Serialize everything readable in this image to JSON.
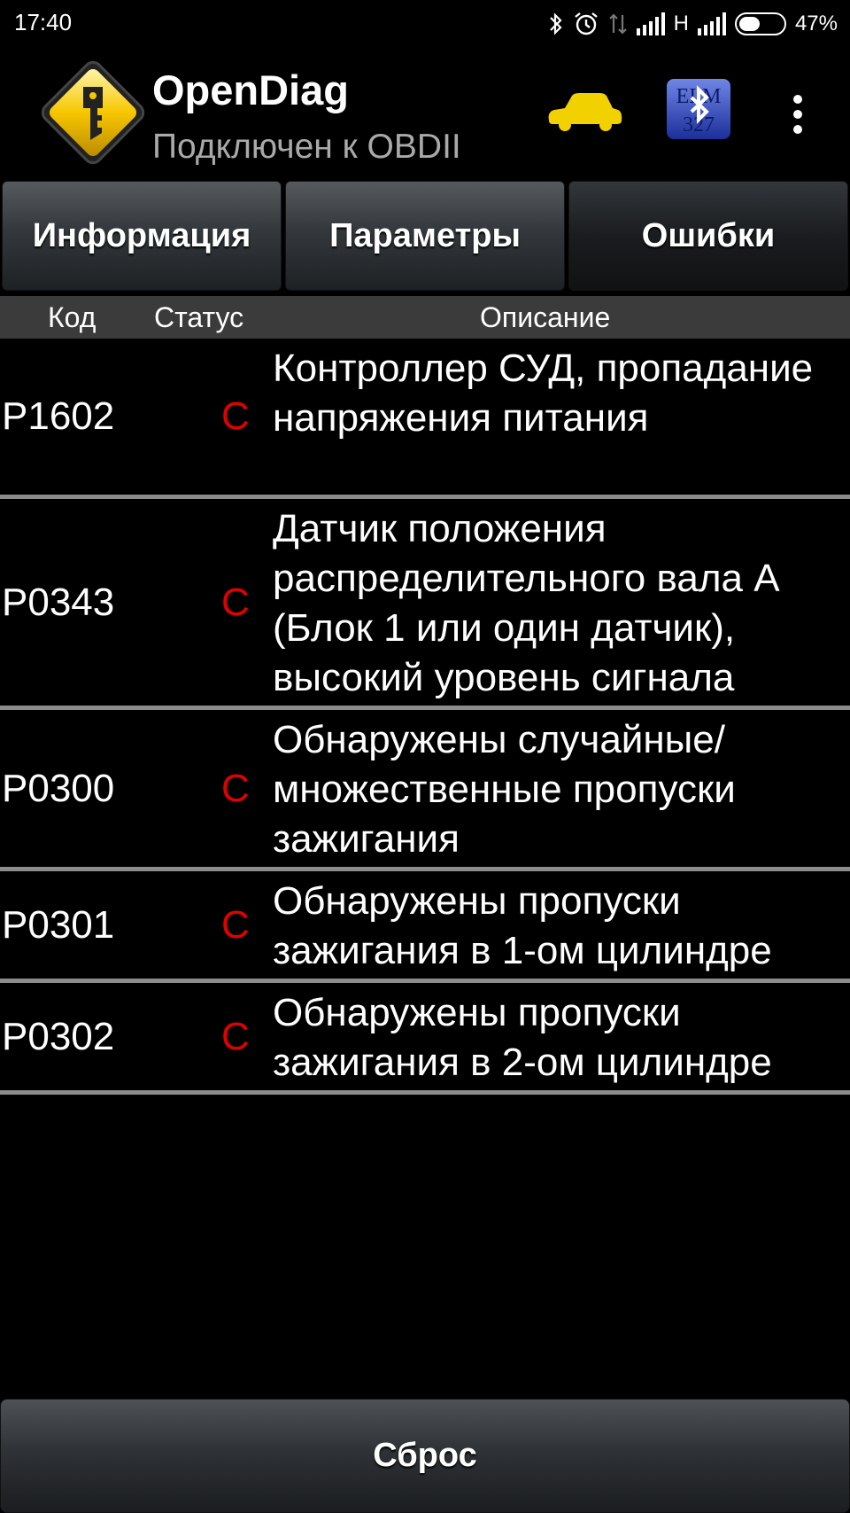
{
  "status_bar": {
    "time": "17:40",
    "network_label": "H",
    "battery_text": "47%",
    "battery_level": 0.47
  },
  "header": {
    "title": "OpenDiag",
    "subtitle": "Подключен к OBDII",
    "car_color": "#f2d100",
    "elm_badge_text": "ELM 327"
  },
  "tabs": [
    {
      "label": "Информация",
      "active": false
    },
    {
      "label": "Параметры",
      "active": false
    },
    {
      "label": "Ошибки",
      "active": true
    }
  ],
  "table": {
    "columns": [
      "Код",
      "Статус",
      "Описание"
    ],
    "status_color": "#e00000",
    "rows": [
      {
        "code": "P1602",
        "status": "C",
        "description": "Контроллер СУД, пропадание напряжения питания"
      },
      {
        "code": "P0343",
        "status": "C",
        "description": "Датчик положения распределительного вала А (Блок 1 или один датчик), высокий уровень сигнала"
      },
      {
        "code": "P0300",
        "status": "C",
        "description": "Обнаружены случайные/ множественные пропуски зажигания"
      },
      {
        "code": "P0301",
        "status": "C",
        "description": "Обнаружены пропуски зажигания в 1-ом цилиндре"
      },
      {
        "code": "P0302",
        "status": "C",
        "description": "Обнаружены пропуски зажигания в 2-ом цилиндре"
      }
    ]
  },
  "footer": {
    "reset_label": "Сброс"
  }
}
